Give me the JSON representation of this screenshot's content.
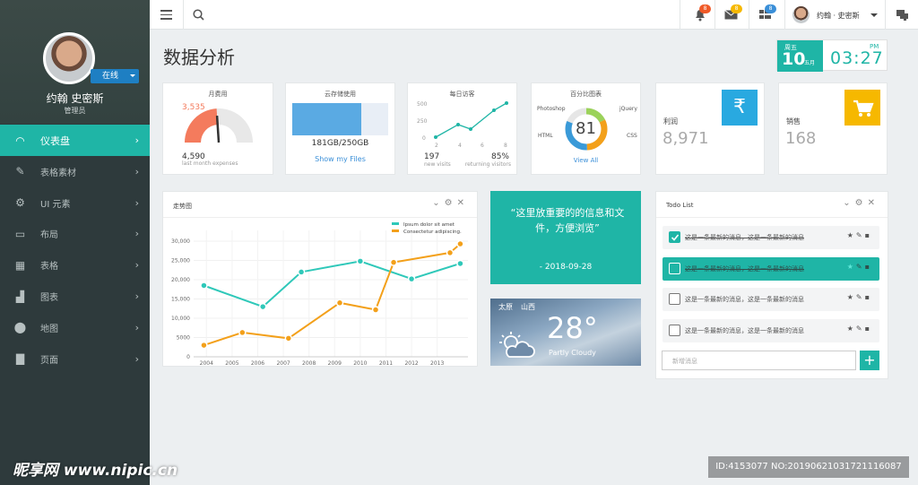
{
  "sidebar": {
    "status": "在线",
    "user_name": "约翰  史密斯",
    "role": "管理员",
    "items": [
      {
        "label": "仪表盘",
        "icon": "dashboard-icon",
        "active": true
      },
      {
        "label": "表格素材",
        "icon": "pencil-icon",
        "active": false
      },
      {
        "label": "UI 元素",
        "icon": "gear-icon",
        "active": false
      },
      {
        "label": "布局",
        "icon": "monitor-icon",
        "active": false
      },
      {
        "label": "表格",
        "icon": "table-icon",
        "active": false
      },
      {
        "label": "图表",
        "icon": "bar-chart-icon",
        "active": false
      },
      {
        "label": "地图",
        "icon": "map-pin-icon",
        "active": false
      },
      {
        "label": "页面",
        "icon": "folder-icon",
        "active": false
      }
    ]
  },
  "header": {
    "notifications_count": "8",
    "messages_count": "8",
    "tasks_count": "8",
    "user_name": "约翰 · 史密斯"
  },
  "page": {
    "title": "数据分析",
    "clock": {
      "weekday": "周五",
      "date": "10",
      "month": "五月",
      "time": "03:27",
      "ampm": "PM"
    }
  },
  "stats": {
    "monthly": {
      "title": "月费用",
      "value": "3,535",
      "sub_value": "4,590",
      "sub_label": "last month expenses",
      "gauge_fraction": 0.48
    },
    "storage": {
      "title": "云存储使用",
      "used": "181GB/250GB",
      "link": "Show my Files",
      "fraction": 0.72
    },
    "visitors": {
      "title": "每日访客",
      "y_ticks": [
        "500",
        "250",
        "0"
      ],
      "x_ticks": [
        "2",
        "4",
        "6",
        "8"
      ],
      "new_visits": "197",
      "new_visits_label": "new visits",
      "returning": "85%",
      "returning_label": "returning visitors"
    },
    "percent": {
      "title": "百分比图表",
      "value": "81",
      "labels": [
        "Photoshop",
        "jQuery",
        "HTML",
        "CSS"
      ],
      "link": "View All"
    },
    "profit": {
      "label": "利润",
      "value": "8,971",
      "color": "#29a9e0"
    },
    "sales": {
      "label": "销售",
      "value": "168",
      "color": "#f6b800"
    }
  },
  "trend": {
    "title": "走势图",
    "legend": [
      "Ipsum dolor sit amet",
      "Consectetur adipiscing."
    ],
    "colors": [
      "#2fc8b9",
      "#f3a01a"
    ]
  },
  "chart_data": {
    "type": "line",
    "title": "走势图",
    "x": [
      2003,
      2005,
      2007,
      2008,
      2010,
      2011,
      2012,
      2013
    ],
    "x_ticks": [
      "2004",
      "2005",
      "2006",
      "2007",
      "2008",
      "2009",
      "2010",
      "2011",
      "2012",
      "2013"
    ],
    "y_ticks": [
      "30,000",
      "25,000",
      "20,000",
      "15,000",
      "10,000",
      "5000",
      "0"
    ],
    "ylim": [
      0,
      30000
    ],
    "series": [
      {
        "name": "Ipsum dolor sit amet",
        "points": [
          [
            2003.9,
            18500
          ],
          [
            2006.2,
            13000
          ],
          [
            2007.7,
            22000
          ],
          [
            2010.0,
            24800
          ],
          [
            2012.0,
            20200
          ],
          [
            2013.9,
            24200
          ]
        ]
      },
      {
        "name": "Consectetur adipiscing.",
        "points": [
          [
            2003.9,
            3000
          ],
          [
            2005.4,
            6300
          ],
          [
            2007.2,
            4800
          ],
          [
            2009.2,
            14000
          ],
          [
            2010.6,
            12200
          ],
          [
            2011.3,
            24500
          ],
          [
            2013.5,
            27000
          ],
          [
            2013.9,
            29300
          ]
        ]
      }
    ]
  },
  "quote": {
    "text": "“这里放重要的的信息和文件，方便浏览”",
    "date": "- 2018-09-28"
  },
  "weather": {
    "city": "太原",
    "province": "山西",
    "temp": "28°",
    "condition": "Partly Cloudy"
  },
  "todo": {
    "title": "Todo List",
    "items": [
      {
        "text": "这是一条最新的消息，这是一条最新的消息",
        "done": true,
        "highlight": false
      },
      {
        "text": "这是一条最新的消息，这是一条最新的消息",
        "done": true,
        "highlight": true
      },
      {
        "text": "这是一条最新的消息，这是一条最新的消息",
        "done": false,
        "highlight": false
      },
      {
        "text": "这是一条最新的消息，这是一条最新的消息",
        "done": false,
        "highlight": false
      }
    ],
    "placeholder": "新增消息",
    "add_label": "+"
  },
  "watermark": {
    "site": "昵享网 www.nipic.cn",
    "id": "ID:4153077 NO:20190621031721116087"
  }
}
